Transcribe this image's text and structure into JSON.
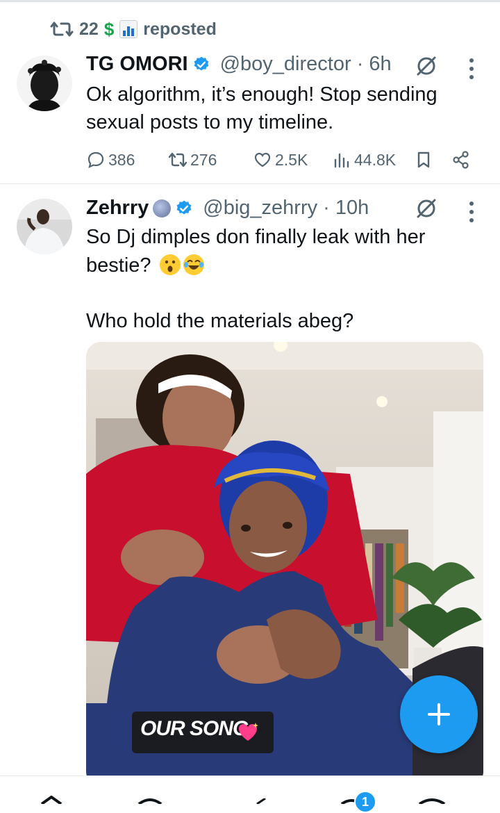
{
  "repost_header": {
    "count": "22",
    "dollar": "$",
    "label": "reposted"
  },
  "post1": {
    "name": "TG OMORI",
    "handle": "@boy_director · 6h",
    "text": "Ok algorithm, it’s enough! Stop sending sexual posts to my timeline.",
    "replies": "386",
    "reposts": "276",
    "likes": "2.5K",
    "views": "44.8K"
  },
  "post2": {
    "name": "Zehrry",
    "handle": "@big_zehrry · 10h",
    "text_line1": "So Dj dimples don finally leak with her",
    "text_line2": "bestie?",
    "text_line3": "Who hold the materials abeg?",
    "media_caption": "OUR SONG"
  },
  "fab_label": "+",
  "nav": {
    "notification_badge": "1"
  },
  "colors": {
    "accent": "#1d9bf0",
    "muted": "#536471",
    "text": "#0f1419"
  }
}
